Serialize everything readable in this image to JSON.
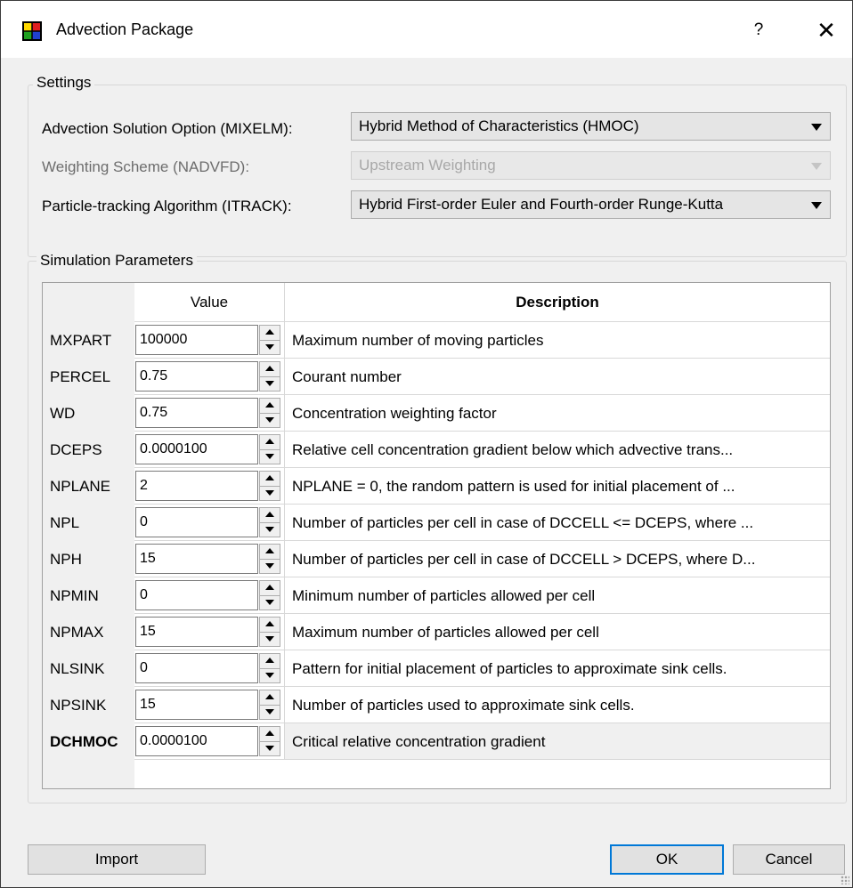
{
  "window": {
    "title": "Advection Package",
    "help_label": "?",
    "close_label": "✕",
    "app_icon": "multicolor-grid-icon"
  },
  "settings": {
    "group_title": "Settings",
    "rows": [
      {
        "label": "Advection Solution Option (MIXELM):",
        "value": "Hybrid Method of Characteristics (HMOC)",
        "enabled": true
      },
      {
        "label": "Weighting Scheme (NADVFD):",
        "value": "Upstream Weighting",
        "enabled": false
      },
      {
        "label": "Particle-tracking Algorithm (ITRACK):",
        "value": "Hybrid First-order Euler and Fourth-order Runge-Kutta",
        "enabled": true
      }
    ]
  },
  "simulation": {
    "group_title": "Simulation Parameters",
    "columns": {
      "value": "Value",
      "description": "Description"
    },
    "rows": [
      {
        "name": "MXPART",
        "value": "100000",
        "description": "Maximum number of moving particles"
      },
      {
        "name": "PERCEL",
        "value": "0.75",
        "description": "Courant number"
      },
      {
        "name": "WD",
        "value": "0.75",
        "description": "Concentration weighting factor"
      },
      {
        "name": "DCEPS",
        "value": "0.0000100",
        "description": "Relative cell concentration gradient below which advective trans..."
      },
      {
        "name": "NPLANE",
        "value": "2",
        "description": "NPLANE = 0, the random pattern is used for initial placement of ..."
      },
      {
        "name": "NPL",
        "value": "0",
        "description": "Number of particles per cell in case of DCCELL <= DCEPS, where ..."
      },
      {
        "name": "NPH",
        "value": "15",
        "description": "Number of particles per cell in case of DCCELL > DCEPS, where D..."
      },
      {
        "name": "NPMIN",
        "value": "0",
        "description": "Minimum number of particles allowed per cell"
      },
      {
        "name": "NPMAX",
        "value": "15",
        "description": "Maximum number of particles allowed per cell"
      },
      {
        "name": "NLSINK",
        "value": "0",
        "description": "Pattern for initial placement of particles to approximate sink cells."
      },
      {
        "name": "NPSINK",
        "value": "15",
        "description": "Number of particles used to approximate sink cells."
      },
      {
        "name": "DCHMOC",
        "value": "0.0000100",
        "description": "Critical relative concentration gradient"
      }
    ],
    "selected_row": "DCHMOC"
  },
  "buttons": {
    "import": "Import",
    "ok": "OK",
    "cancel": "Cancel"
  },
  "colors": {
    "window_bg": "#f0f0f0",
    "title_bg": "#ffffff",
    "focus_border": "#0078d7"
  }
}
